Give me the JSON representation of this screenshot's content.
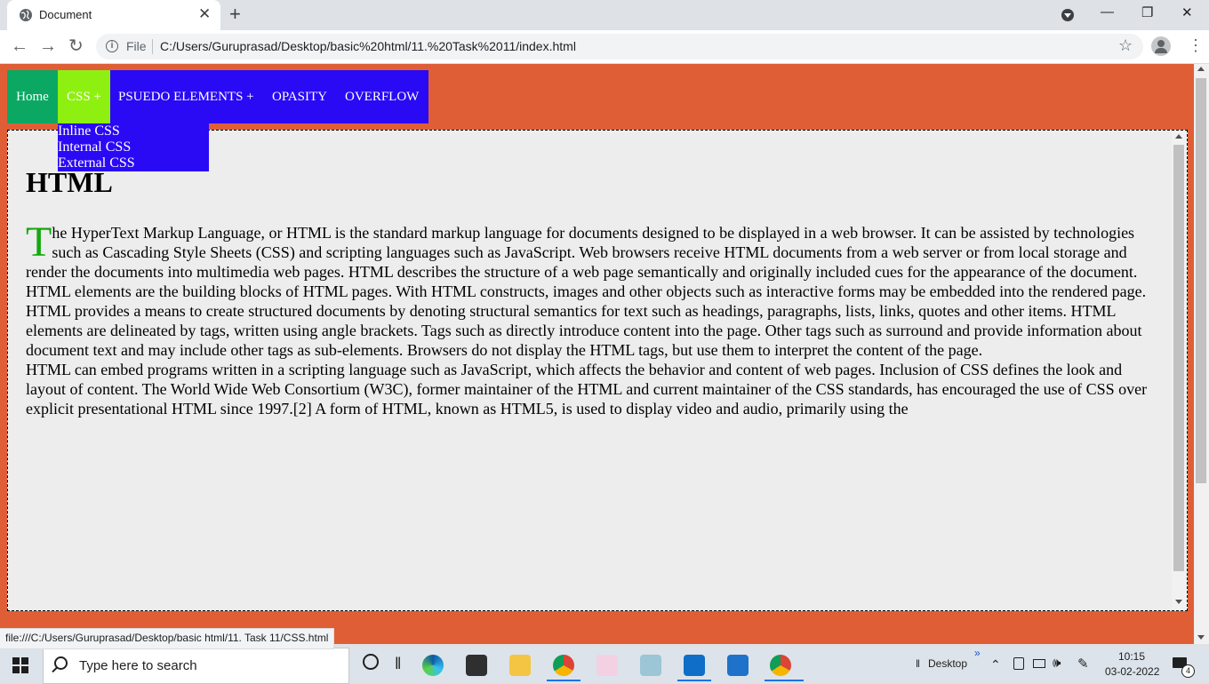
{
  "browser": {
    "tab_title": "Document",
    "tab_close": "✕",
    "new_tab": "+",
    "minimize": "—",
    "restore": "❐",
    "close": "✕",
    "file_label": "File",
    "url": "C:/Users/Guruprasad/Desktop/basic%20html/11.%20Task%2011/index.html",
    "star": "☆",
    "menu": "⋮",
    "back": "←",
    "forward": "→",
    "reload": "↻",
    "status_link": "file:///C:/Users/Guruprasad/Desktop/basic html/11. Task 11/CSS.html"
  },
  "page": {
    "nav": {
      "home": "Home",
      "css": "CSS +",
      "pseudo": "PSUEDO ELEMENTS +",
      "opacity": "OPASITY",
      "overflow": "OVERFLOW"
    },
    "dropdown": [
      "Inline CSS",
      "Internal CSS",
      "External CSS"
    ],
    "heading": "HTML",
    "dropcap": "T",
    "paragraph1": "he HyperText Markup Language, or HTML is the standard markup language for documents designed to be displayed in a web browser. It can be assisted by technologies such as Cascading Style Sheets (CSS) and scripting languages such as JavaScript. Web browsers receive HTML documents from a web server or from local storage and render the documents into multimedia web pages. HTML describes the structure of a web page semantically and originally included cues for the appearance of the document. HTML elements are the building blocks of HTML pages. With HTML constructs, images and other objects such as interactive forms may be embedded into the rendered page. HTML provides a means to create structured documents by denoting structural semantics for text such as headings, paragraphs, lists, links, quotes and other items. HTML elements are delineated by tags, written using angle brackets. Tags such as directly introduce content into the page. Other tags such as surround and provide information about document text and may include other tags as sub-elements. Browsers do not display the HTML tags, but use them to interpret the content of the page.",
    "paragraph2": "HTML can embed programs written in a scripting language such as JavaScript, which affects the behavior and content of web pages. Inclusion of CSS defines the look and layout of content. The World Wide Web Consortium (W3C), former maintainer of the HTML and current maintainer of the CSS standards, has encouraged the use of CSS over explicit presentational HTML since 1997.[2] A form of HTML, known as HTML5, is used to display video and audio, primarily using the"
  },
  "colors": {
    "page_bg": "#e05e36",
    "nav_bg": "#2a09f5",
    "home_bg": "#0aa863",
    "css_bg": "#8ef010",
    "dropcap": "#13a80e",
    "content_bg": "#ededed"
  },
  "taskbar": {
    "search_placeholder": "Type here to search",
    "desktop_label": "Desktop",
    "time": "10:15",
    "date": "03-02-2022",
    "notification_count": "4",
    "chevrons": "»",
    "tray_up": "⌃",
    "volume": "🕪",
    "pen": "✎",
    "task_view": "‖"
  }
}
